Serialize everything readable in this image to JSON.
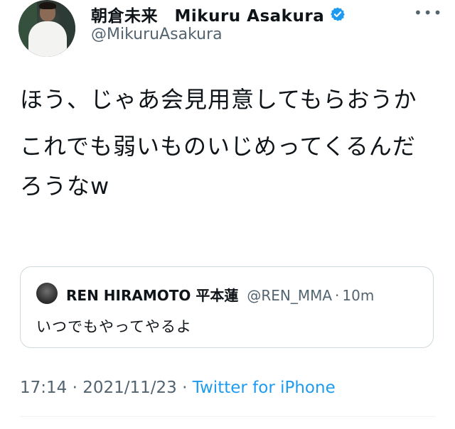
{
  "author": {
    "display_name": "朝倉未来　Mikuru Asakura",
    "handle": "@MikuruAsakura",
    "verified": true
  },
  "tweet": {
    "paragraphs": [
      "ほう、じゃあ会見用意してもらおうか",
      "これでも弱いものいじめってくるんだろうなw"
    ]
  },
  "quoted_tweet": {
    "display_name": "REN HIRAMOTO 平本蓮",
    "handle": "@REN_MMA",
    "separator": "·",
    "time": "10m",
    "text": "いつでもやってやるよ"
  },
  "meta": {
    "time": "17:14",
    "separator": " · ",
    "date": "2021/11/23",
    "source": "Twitter for iPhone"
  },
  "colors": {
    "text": "#0f1419",
    "secondary": "#536471",
    "accent": "#1d9bf0",
    "border": "#cfd9de"
  },
  "icons": {
    "verified": "verified-badge-icon",
    "more": "more-icon"
  }
}
